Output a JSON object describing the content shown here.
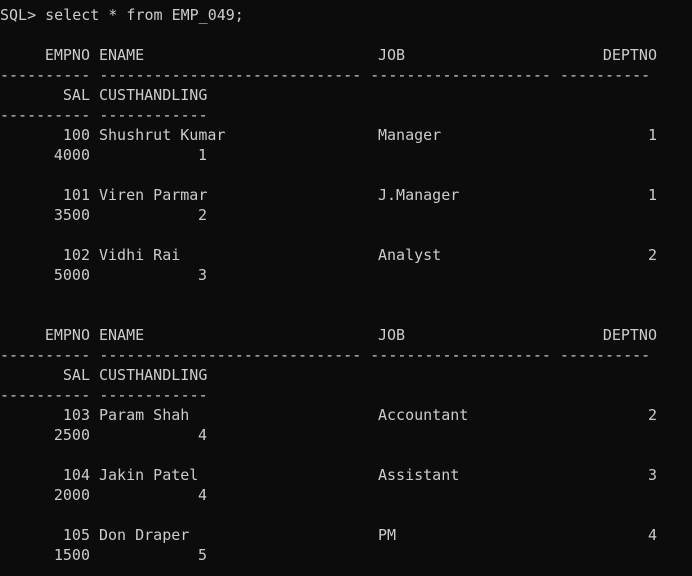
{
  "prompt": "SQL> select * from EMP_049;",
  "headers": {
    "empno": "EMPNO",
    "ename": "ENAME",
    "job": "JOB",
    "deptno": "DEPTNO",
    "sal": "SAL",
    "custhandling": "CUSTHANDLING",
    "divider_line1": "---------- ----------------------------- -------------------- ----------",
    "divider_line2": "---------- ------------"
  },
  "rows": [
    {
      "empno": "100",
      "ename": "Shushrut Kumar",
      "job": "Manager",
      "deptno": "1",
      "sal": "4000",
      "custhandling": "1"
    },
    {
      "empno": "101",
      "ename": "Viren Parmar",
      "job": "J.Manager",
      "deptno": "1",
      "sal": "3500",
      "custhandling": "2"
    },
    {
      "empno": "102",
      "ename": "Vidhi Rai",
      "job": "Analyst",
      "deptno": "2",
      "sal": "5000",
      "custhandling": "3"
    },
    {
      "empno": "103",
      "ename": "Param Shah",
      "job": "Accountant",
      "deptno": "2",
      "sal": "2500",
      "custhandling": "4"
    },
    {
      "empno": "104",
      "ename": "Jakin Patel",
      "job": "Assistant",
      "deptno": "3",
      "sal": "2000",
      "custhandling": "4"
    },
    {
      "empno": "105",
      "ename": "Don Draper",
      "job": "PM",
      "deptno": "4",
      "sal": "1500",
      "custhandling": "5"
    }
  ]
}
